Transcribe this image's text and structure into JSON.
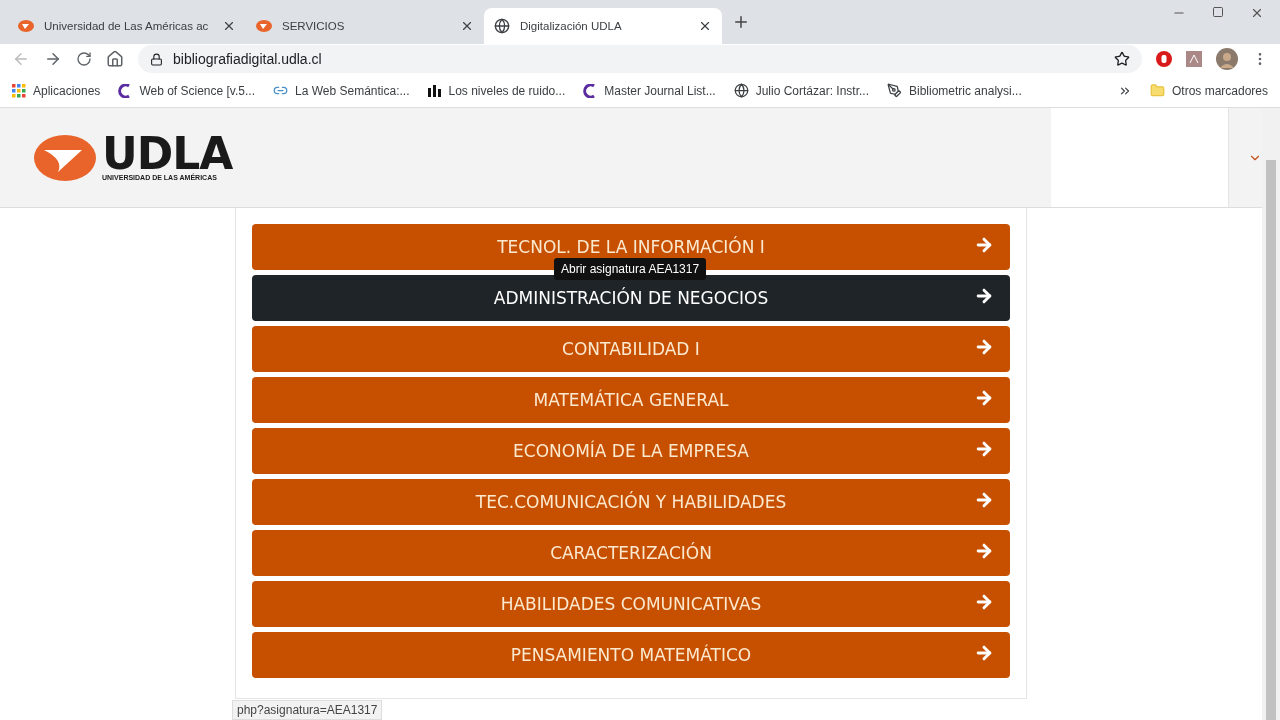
{
  "browser": {
    "tabs": [
      {
        "title": "Universidad de Las Américas ac",
        "kind": "udla",
        "selected": false
      },
      {
        "title": "SERVICIOS",
        "kind": "udla",
        "selected": false
      },
      {
        "title": "Digitalización UDLA",
        "kind": "globe",
        "selected": true
      }
    ],
    "url": "bibliografiadigital.udla.cl",
    "bookmarks": [
      {
        "label": "Aplicaciones",
        "kind": "apps"
      },
      {
        "label": "Web of Science [v.5...",
        "kind": "clarivate"
      },
      {
        "label": "La Web Semántica:...",
        "kind": "link"
      },
      {
        "label": "Los niveles de ruido...",
        "kind": "ibi"
      },
      {
        "label": "Master Journal List...",
        "kind": "clarivate"
      },
      {
        "label": "Julio Cortázar: Instr...",
        "kind": "globe"
      },
      {
        "label": "Bibliometric analysi...",
        "kind": "pen"
      }
    ],
    "other_bookmarks": "Otros marcadores"
  },
  "header": {
    "logo_text": "UDLA",
    "logo_subtitle": "UNIVERSIDAD DE LAS AMÉRICAS"
  },
  "courses": [
    {
      "label": "TECNOL. DE LA INFORMACIÓN I",
      "selected": false
    },
    {
      "label": "ADMINISTRACIÓN DE NEGOCIOS",
      "selected": true
    },
    {
      "label": "CONTABILIDAD I",
      "selected": false
    },
    {
      "label": "MATEMÁTICA GENERAL",
      "selected": false
    },
    {
      "label": "ECONOMÍA DE LA EMPRESA",
      "selected": false
    },
    {
      "label": "TEC.COMUNICACIÓN Y HABILIDADES",
      "selected": false
    },
    {
      "label": "CARACTERIZACIÓN",
      "selected": false
    },
    {
      "label": "HABILIDADES COMUNICATIVAS",
      "selected": false
    },
    {
      "label": "PENSAMIENTO MATEMÁTICO",
      "selected": false
    }
  ],
  "tooltip": "Abrir asignatura AEA1317",
  "status_bar": "php?asignatura=AEA1317"
}
